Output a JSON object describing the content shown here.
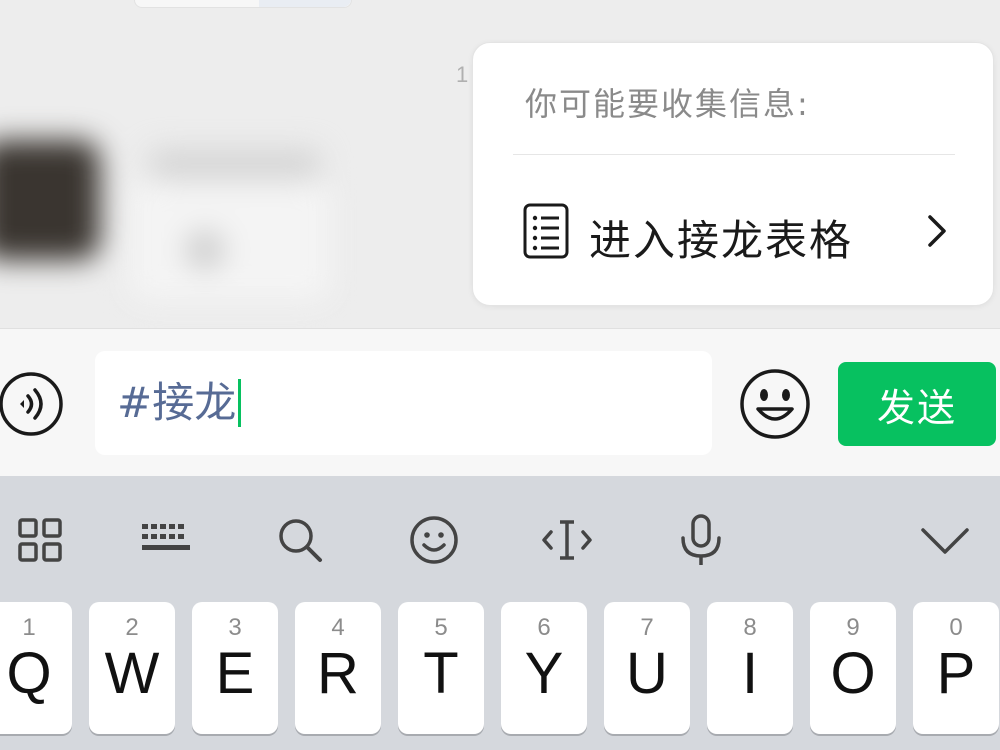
{
  "chat": {
    "timestamp_fragment": "1"
  },
  "suggestion": {
    "heading": "你可能要收集信息:",
    "item_label": "进入接龙表格",
    "item_icon": "document-list-icon",
    "chevron_icon": "chevron-right-icon"
  },
  "input_bar": {
    "voice_icon": "voice-input-icon",
    "input_value": "#接龙",
    "emoji_icon": "emoji-icon",
    "send_label": "发送",
    "send_color": "#07c160",
    "input_text_color": "#576b95"
  },
  "keyboard": {
    "toolbar": [
      {
        "icon": "grid-icon"
      },
      {
        "icon": "keyboard-icon"
      },
      {
        "icon": "search-icon"
      },
      {
        "icon": "emoji-icon"
      },
      {
        "icon": "text-cursor-icon"
      },
      {
        "icon": "microphone-icon"
      },
      {
        "icon": "chevron-down-icon"
      }
    ],
    "keys": [
      {
        "num": "1",
        "letter": "Q"
      },
      {
        "num": "2",
        "letter": "W"
      },
      {
        "num": "3",
        "letter": "E"
      },
      {
        "num": "4",
        "letter": "R"
      },
      {
        "num": "5",
        "letter": "T"
      },
      {
        "num": "6",
        "letter": "Y"
      },
      {
        "num": "7",
        "letter": "U"
      },
      {
        "num": "8",
        "letter": "I"
      },
      {
        "num": "9",
        "letter": "O"
      },
      {
        "num": "0",
        "letter": "P"
      }
    ]
  }
}
